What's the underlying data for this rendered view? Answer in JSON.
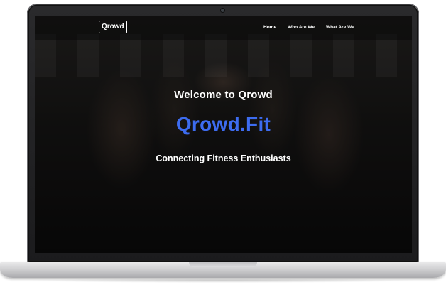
{
  "navbar": {
    "logo": "Qrowd",
    "links": [
      {
        "label": "Home",
        "active": true
      },
      {
        "label": "Who Are We",
        "active": false
      },
      {
        "label": "What Are We",
        "active": false
      }
    ]
  },
  "hero": {
    "welcome": "Welcome to Qrowd",
    "brand": "Qrowd.Fit",
    "tagline": "Connecting Fitness Enthusiasts"
  },
  "colors": {
    "accent": "#3d6cf0",
    "nav_background": "#0a0a0a",
    "bezel": "#1b1b1d",
    "base": "#cfcfd1"
  }
}
